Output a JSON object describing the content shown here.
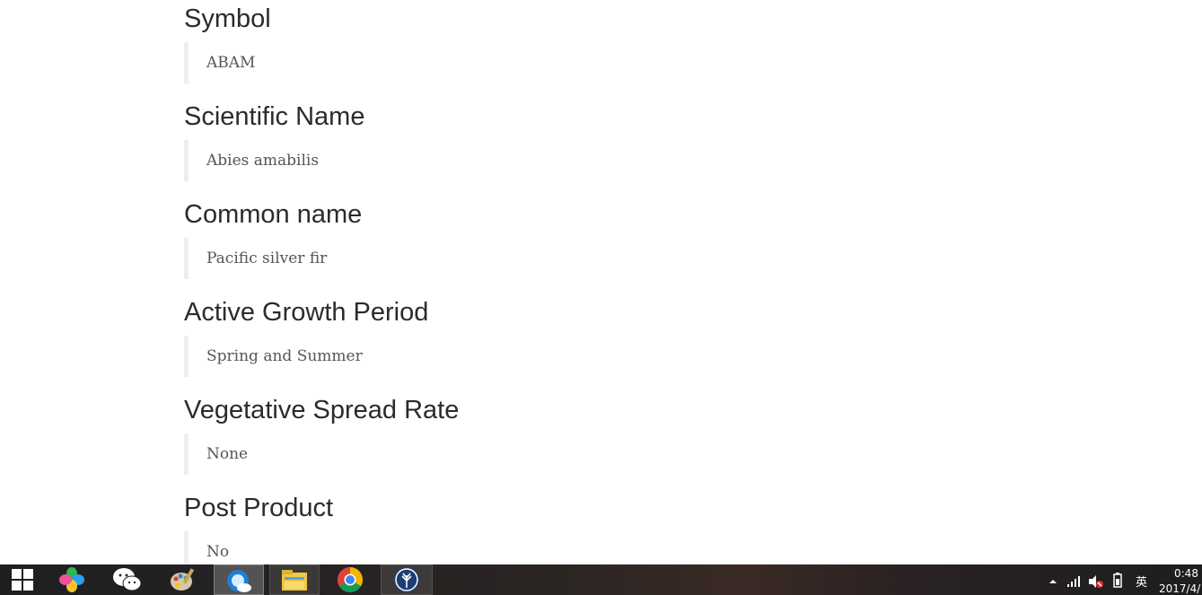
{
  "fields": [
    {
      "heading": "Symbol",
      "value": "ABAM"
    },
    {
      "heading": "Scientific Name",
      "value": "Abies amabilis"
    },
    {
      "heading": "Common name",
      "value": "Pacific silver fir"
    },
    {
      "heading": "Active Growth Period",
      "value": "Spring and Summer"
    },
    {
      "heading": "Vegetative Spread Rate",
      "value": "None"
    },
    {
      "heading": "Post Product",
      "value": "No"
    }
  ],
  "taskbar": {
    "apps": [
      {
        "icon": "windows-start-icon"
      },
      {
        "icon": "pinwheel-app-icon"
      },
      {
        "icon": "wechat-icon"
      },
      {
        "icon": "paint-palette-icon"
      },
      {
        "icon": "browser-cloud-icon",
        "state": "active"
      },
      {
        "icon": "file-explorer-icon",
        "state": "open"
      },
      {
        "icon": "chrome-icon"
      },
      {
        "icon": "tree-app-icon",
        "state": "open"
      }
    ],
    "tray": {
      "time": "0:48",
      "date": "2017/4/",
      "ime": "英",
      "icons": [
        "show-hidden-icons-icon",
        "network-signal-icon",
        "volume-muted-icon",
        "power-icon"
      ]
    },
    "colors": {
      "background": "#1f1f21"
    }
  },
  "colors": {
    "heading": "#2b2b2b",
    "value": "#555555",
    "quote_border": "#eeeeee"
  }
}
